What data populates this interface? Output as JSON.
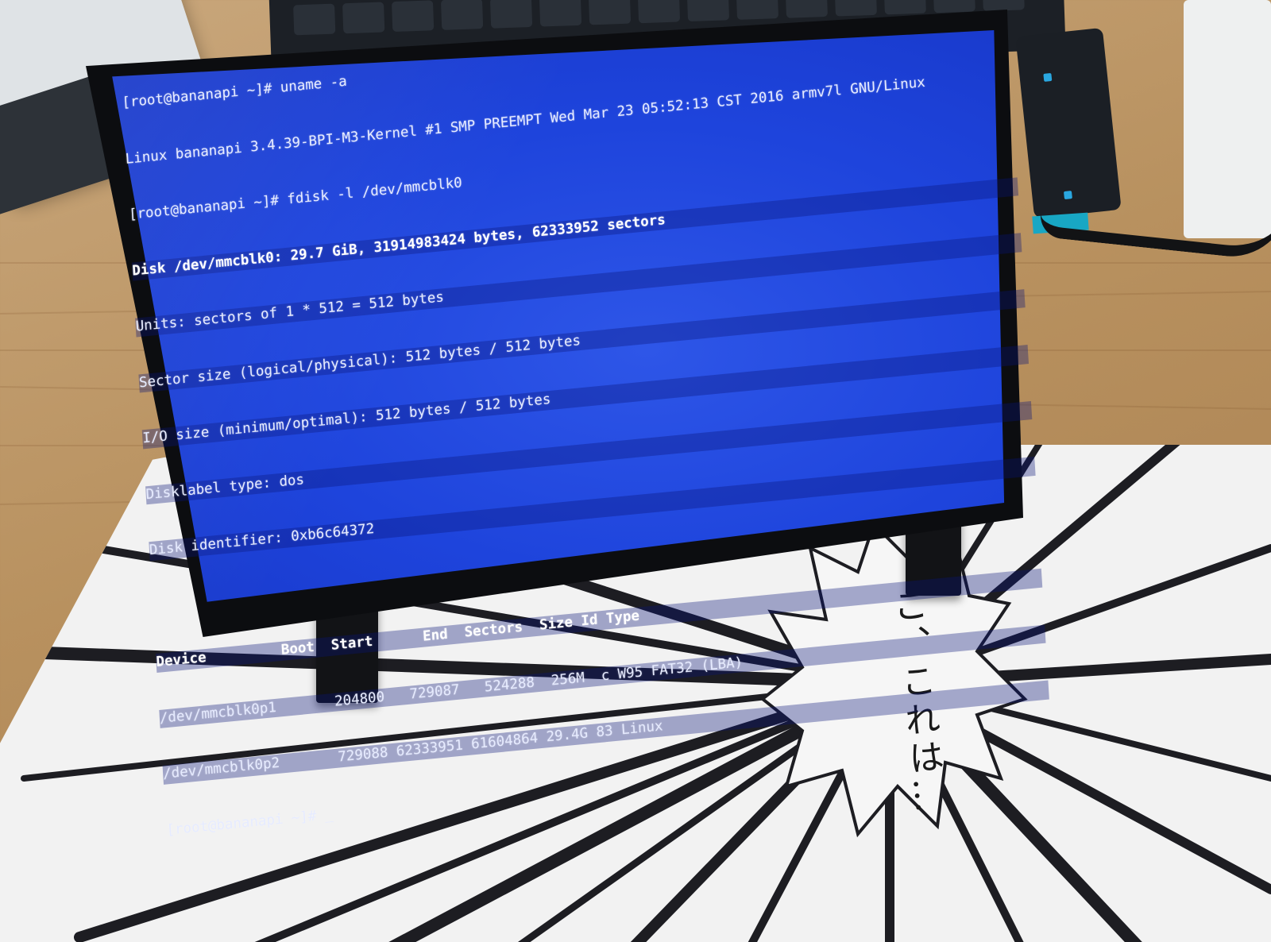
{
  "terminal": {
    "lines": [
      "[root@bananapi ~]# uname -a",
      "Linux bananapi 3.4.39-BPI-M3-Kernel #1 SMP PREEMPT Wed Mar 23 05:52:13 CST 2016 armv7l GNU/Linux",
      "[root@bananapi ~]# fdisk -l /dev/mmcblk0",
      "Disk /dev/mmcblk0: 29.7 GiB, 31914983424 bytes, 62333952 sectors",
      "Units: sectors of 1 * 512 = 512 bytes",
      "Sector size (logical/physical): 512 bytes / 512 bytes",
      "I/O size (minimum/optimal): 512 bytes / 512 bytes",
      "Disklabel type: dos",
      "Disk identifier: 0xb6c64372",
      "",
      "Device         Boot  Start      End  Sectors  Size Id Type",
      "/dev/mmcblk0p1       204800   729087   524288  256M  c W95 FAT32 (LBA)",
      "/dev/mmcblk0p2       729088 62333951 61604864 29.4G 83 Linux",
      "[root@bananapi ~]# _"
    ]
  },
  "mousepad": {
    "text": "こ、これは…"
  }
}
